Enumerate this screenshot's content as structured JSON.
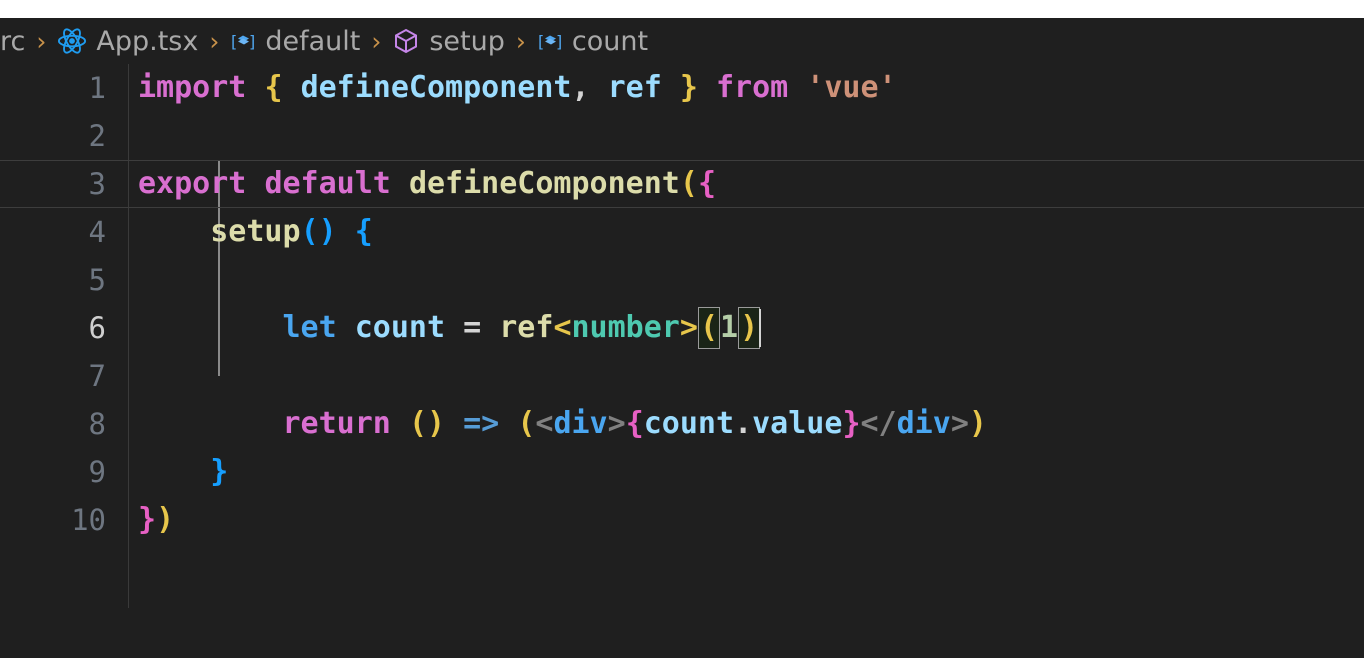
{
  "window": {
    "background": "#1f1f1f",
    "top_strip_color": "#ffffff"
  },
  "breadcrumb": {
    "items": [
      {
        "label": "rc",
        "icon": ""
      },
      {
        "label": "App.tsx",
        "icon": "react-icon"
      },
      {
        "label": "default",
        "icon": "at-symbol-icon"
      },
      {
        "label": "setup",
        "icon": "cube-icon"
      },
      {
        "label": "count",
        "icon": "at-symbol-icon"
      }
    ],
    "separator": "›"
  },
  "editor": {
    "active_line": 6,
    "cursor_line": 6,
    "cursor_column": 38,
    "language": "tsx",
    "lines": [
      {
        "number": "1",
        "text": "import { defineComponent, ref } from 'vue'"
      },
      {
        "number": "2",
        "text": ""
      },
      {
        "number": "3",
        "text": "export default defineComponent({"
      },
      {
        "number": "4",
        "text": "    setup() {"
      },
      {
        "number": "5",
        "text": ""
      },
      {
        "number": "6",
        "text": "        let count = ref<number>(1)"
      },
      {
        "number": "7",
        "text": ""
      },
      {
        "number": "8",
        "text": "        return () => (<div>{count.value}</div>)"
      },
      {
        "number": "9",
        "text": "    }"
      },
      {
        "number": "10",
        "text": "})"
      }
    ],
    "tokens": {
      "l1": {
        "import": "import",
        "brace_open": "{",
        "defineComponent": "defineComponent",
        "comma": ",",
        "ref": "ref",
        "brace_close": "}",
        "from": "from",
        "module": "'vue'"
      },
      "l3": {
        "export": "export",
        "default": "default",
        "call": "defineComponent",
        "paren": "(",
        "brace": "{"
      },
      "l4": {
        "setup": "setup",
        "parens": "()",
        "brace": "{"
      },
      "l6": {
        "let": "let",
        "name": "count",
        "equals": "=",
        "ref": "ref",
        "lt": "<",
        "type": "number",
        "gt": ">",
        "paren_open": "(",
        "value": "1",
        "paren_close": ")"
      },
      "l8": {
        "return": "return",
        "parens": "()",
        "arrow": "=>",
        "paren_open": "(",
        "lt": "<",
        "tag": "div",
        "gt": ">",
        "brace_open": "{",
        "obj": "count",
        "dot": ".",
        "prop": "value",
        "brace_close": "}",
        "close_lt": "</",
        "close_tag": "div",
        "close_gt": ">",
        "paren_close": ")"
      },
      "l9": {
        "brace": "}"
      },
      "l10": {
        "brace": "}",
        "paren": ")"
      }
    },
    "colors": {
      "keyword": "#d96fd0",
      "function": "#dcdcaa",
      "identifier": "#9cdcfe",
      "string": "#ce9178",
      "type": "#4ec9b0",
      "number_literal": "#b5cea8",
      "bracket_yellow": "#e7c64b",
      "bracket_pink": "#e760c4",
      "bracket_blue": "#169fff",
      "tag": "#808080",
      "line_number": "#6e7681",
      "active_line_number": "#cfcfcf"
    }
  }
}
